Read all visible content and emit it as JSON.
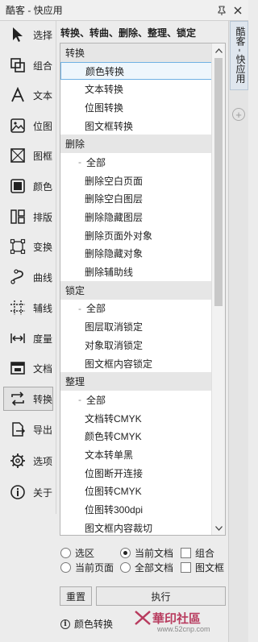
{
  "window": {
    "title": "酷客 - 快应用",
    "pin_icon": "pin-icon",
    "close_icon": "close-icon"
  },
  "tools": [
    {
      "name": "select",
      "label": "选择",
      "icon": "arrow-pointer-icon"
    },
    {
      "name": "group",
      "label": "组合",
      "icon": "group-icon"
    },
    {
      "name": "text",
      "label": "文本",
      "icon": "text-icon"
    },
    {
      "name": "bitmap",
      "label": "位图",
      "icon": "image-icon"
    },
    {
      "name": "frame",
      "label": "图框",
      "icon": "frame-icon"
    },
    {
      "name": "color",
      "label": "颜色",
      "icon": "color-icon"
    },
    {
      "name": "layout",
      "label": "排版",
      "icon": "layout-icon"
    },
    {
      "name": "transform",
      "label": "变换",
      "icon": "transform-icon"
    },
    {
      "name": "curve",
      "label": "曲线",
      "icon": "curve-icon"
    },
    {
      "name": "guides",
      "label": "辅线",
      "icon": "guides-icon"
    },
    {
      "name": "measure",
      "label": "度量",
      "icon": "measure-icon"
    },
    {
      "name": "document",
      "label": "文档",
      "icon": "document-icon"
    },
    {
      "name": "convert",
      "label": "转换",
      "icon": "convert-icon",
      "active": true
    },
    {
      "name": "export",
      "label": "导出",
      "icon": "export-icon"
    },
    {
      "name": "options",
      "label": "选项",
      "icon": "gear-icon"
    },
    {
      "name": "about",
      "label": "关于",
      "icon": "info-icon"
    }
  ],
  "panel": {
    "heading": "转换、转曲、删除、整理、锁定"
  },
  "list": [
    {
      "type": "group",
      "label": "转换"
    },
    {
      "type": "item",
      "label": "颜色转换",
      "selected": true
    },
    {
      "type": "item",
      "label": "文本转换"
    },
    {
      "type": "item",
      "label": "位图转换"
    },
    {
      "type": "item",
      "label": "图文框转换"
    },
    {
      "type": "group",
      "label": "删除"
    },
    {
      "type": "sub",
      "label": "全部"
    },
    {
      "type": "item",
      "label": "删除空白页面"
    },
    {
      "type": "item",
      "label": "删除空白图层"
    },
    {
      "type": "item",
      "label": "删除隐藏图层"
    },
    {
      "type": "item",
      "label": "删除页面外对象"
    },
    {
      "type": "item",
      "label": "删除隐藏对象"
    },
    {
      "type": "item",
      "label": "删除辅助线"
    },
    {
      "type": "group",
      "label": "锁定"
    },
    {
      "type": "sub",
      "label": "全部"
    },
    {
      "type": "item",
      "label": "图层取消锁定"
    },
    {
      "type": "item",
      "label": "对象取消锁定"
    },
    {
      "type": "item",
      "label": "图文框内容锁定"
    },
    {
      "type": "group",
      "label": "整理"
    },
    {
      "type": "sub",
      "label": "全部"
    },
    {
      "type": "item",
      "label": "文档转CMYK"
    },
    {
      "type": "item",
      "label": "颜色转CMYK"
    },
    {
      "type": "item",
      "label": "文本转单黑"
    },
    {
      "type": "item",
      "label": "位图断开连接"
    },
    {
      "type": "item",
      "label": "位图转CMYK"
    },
    {
      "type": "item",
      "label": "位图转300dpi"
    },
    {
      "type": "item",
      "label": "图文框内容裁切"
    }
  ],
  "scope": {
    "selection": {
      "label": "选区",
      "checked": false
    },
    "current_doc": {
      "label": "当前文档",
      "checked": true
    },
    "group": {
      "label": "组合",
      "checked": false
    },
    "current_page": {
      "label": "当前页面",
      "checked": false
    },
    "all_docs": {
      "label": "全部文档",
      "checked": false
    },
    "textframe": {
      "label": "图文框",
      "checked": false
    }
  },
  "buttons": {
    "reset": "重置",
    "execute": "执行"
  },
  "status": {
    "text": "颜色转换"
  },
  "right_tab": {
    "label": "酷客 - 快应用",
    "add_icon": "plus-circle-icon"
  },
  "watermark": {
    "text": "華印社區",
    "url": "www.52cnp.com"
  },
  "colors": {
    "selection_border": "#6fb1e3",
    "group_bg": "#e6e6e6",
    "watermark": "#b83b5e"
  }
}
